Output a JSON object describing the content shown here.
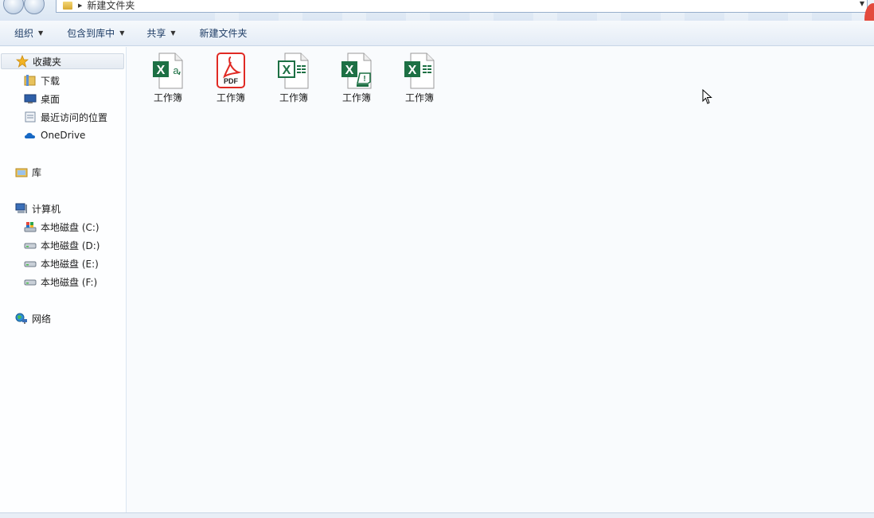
{
  "address_bar": {
    "breadcrumb": "新建文件夹"
  },
  "toolbar": {
    "organize": "组织",
    "include_in_library": "包含到库中",
    "share": "共享",
    "new_folder": "新建文件夹"
  },
  "sidebar": {
    "favorites": {
      "label": "收藏夹",
      "items": [
        {
          "label": "下载",
          "icon": "download-folder-icon"
        },
        {
          "label": "桌面",
          "icon": "desktop-icon"
        },
        {
          "label": "最近访问的位置",
          "icon": "recent-places-icon"
        },
        {
          "label": "OneDrive",
          "icon": "onedrive-cloud-icon"
        }
      ]
    },
    "libraries": {
      "label": "库"
    },
    "computer": {
      "label": "计算机",
      "drives": [
        {
          "label": "本地磁盘 (C:)"
        },
        {
          "label": "本地磁盘 (D:)"
        },
        {
          "label": "本地磁盘 (E:)"
        },
        {
          "label": "本地磁盘 (F:)"
        }
      ]
    },
    "network": {
      "label": "网络"
    }
  },
  "files": [
    {
      "name": "工作簿",
      "icon": "excel-xa-icon",
      "color": "#1d7044"
    },
    {
      "name": "工作簿",
      "icon": "pdf-icon",
      "color": "#e02a24"
    },
    {
      "name": "工作簿",
      "icon": "excel-grid-icon",
      "color": "#1d7044"
    },
    {
      "name": "工作簿",
      "icon": "excel-macro-icon",
      "color": "#1d7044"
    },
    {
      "name": "工作簿",
      "icon": "excel-workbook-icon",
      "color": "#1d7044"
    }
  ]
}
